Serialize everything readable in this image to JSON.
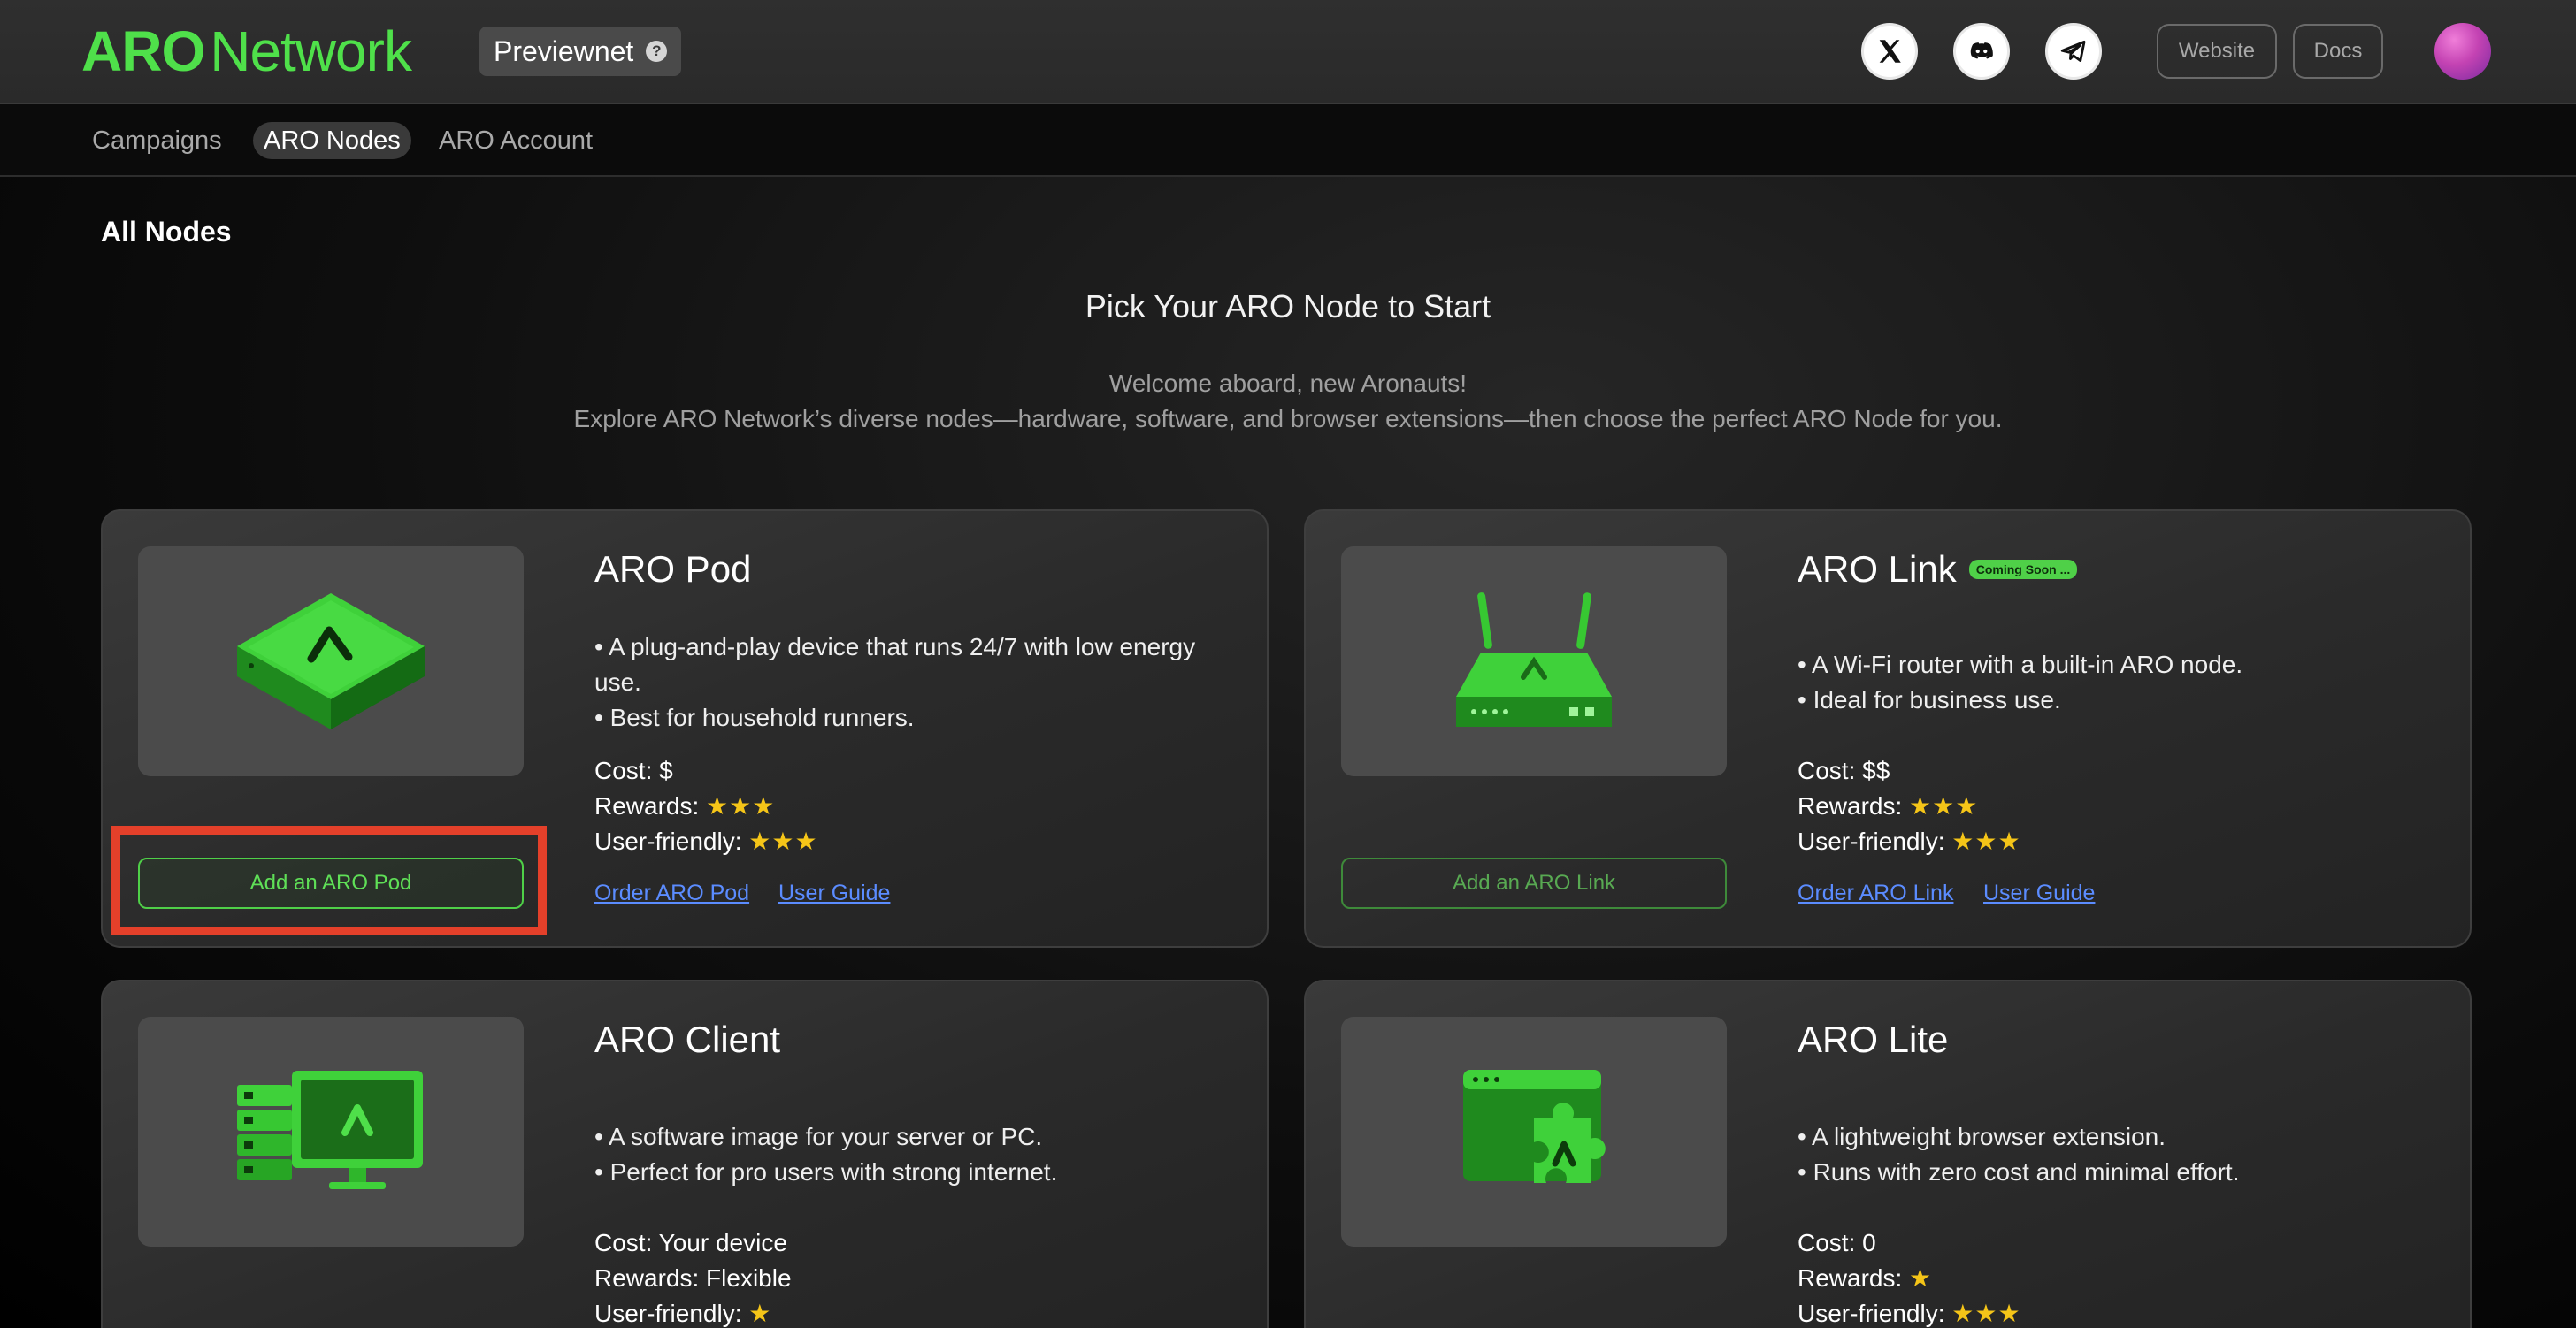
{
  "header": {
    "brand_part1": "ARO",
    "brand_part2": "Network",
    "network_label": "Previewnet",
    "help_icon_glyph": "?",
    "website_label": "Website",
    "docs_label": "Docs",
    "social_icons": [
      "x-icon",
      "discord-icon",
      "telegram-icon"
    ]
  },
  "subnav": {
    "tabs": [
      {
        "label": "Campaigns",
        "active": false
      },
      {
        "label": "ARO Nodes",
        "active": true
      },
      {
        "label": "ARO Account",
        "active": false
      }
    ]
  },
  "main": {
    "section_title": "All Nodes",
    "headline": "Pick Your ARO Node to Start",
    "welcome": "Welcome aboard, new Aronauts!",
    "explore": "Explore ARO Network’s diverse nodes—hardware, software, and browser extensions—then choose the perfect ARO Node for you."
  },
  "cards": [
    {
      "title": "ARO Pod",
      "badge": "",
      "desc1": "• A plug-and-play device that runs 24/7 with low energy use.",
      "desc2": "• Best for household runners.",
      "cost": "Cost: $",
      "rewards_label": "Rewards: ",
      "rewards_stars": "★★★",
      "friendly_label": "User-friendly: ",
      "friendly_stars": "★★★",
      "button": "Add an ARO Pod",
      "link1": "Order ARO Pod",
      "link2": "User Guide",
      "icon": "pod-device-icon"
    },
    {
      "title": "ARO Link",
      "badge": "Coming Soon ...",
      "desc1": "• A Wi-Fi router with a built-in ARO node.",
      "desc2": "• Ideal for business use.",
      "cost": "Cost: $$",
      "rewards_label": "Rewards: ",
      "rewards_stars": "★★★",
      "friendly_label": "User-friendly: ",
      "friendly_stars": "★★★",
      "button": "Add an ARO Link",
      "link1": "Order ARO Link",
      "link2": "User Guide",
      "icon": "router-icon"
    },
    {
      "title": "ARO Client",
      "badge": "",
      "desc1": "• A software image for your server or PC.",
      "desc2": "• Perfect for pro users with strong internet.",
      "cost": "Cost: Your device",
      "rewards_label": "Rewards: Flexible",
      "rewards_stars": "",
      "friendly_label": "User-friendly: ",
      "friendly_stars": "★",
      "icon": "server-monitor-icon"
    },
    {
      "title": "ARO Lite",
      "badge": "",
      "desc1": "• A lightweight browser extension.",
      "desc2": "• Runs with zero cost and minimal effort.",
      "cost": "Cost: 0",
      "rewards_label": "Rewards: ",
      "rewards_stars": "★",
      "friendly_label": "User-friendly: ",
      "friendly_stars": "★★★",
      "icon": "browser-extension-icon"
    }
  ],
  "colors": {
    "brand_green": "#4fe04a",
    "highlight_red": "#e4402a",
    "link_blue": "#5b8cff"
  }
}
